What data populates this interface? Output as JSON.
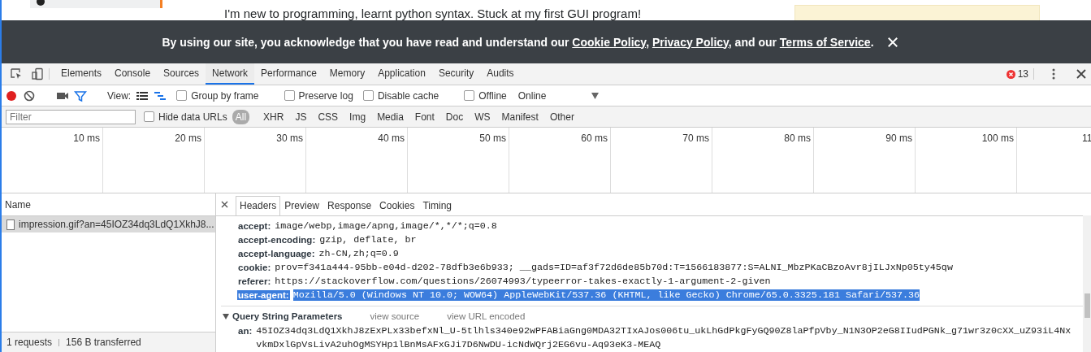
{
  "page": {
    "question": "I'm new to programming, learnt python syntax. Stuck at my first GUI program!"
  },
  "cookie_banner": {
    "segments": [
      {
        "kind": "text",
        "text": "By using our site, you acknowledge that you have read and understand our "
      },
      {
        "kind": "link",
        "text": "Cookie Policy"
      },
      {
        "kind": "text",
        "text": ", "
      },
      {
        "kind": "link",
        "text": "Privacy Policy"
      },
      {
        "kind": "text",
        "text": ", and our "
      },
      {
        "kind": "link",
        "text": "Terms of Service"
      },
      {
        "kind": "text",
        "text": "."
      }
    ]
  },
  "devtools": {
    "tabs": [
      {
        "label": "Elements",
        "selected": false
      },
      {
        "label": "Console",
        "selected": false
      },
      {
        "label": "Sources",
        "selected": false
      },
      {
        "label": "Network",
        "selected": true
      },
      {
        "label": "Performance",
        "selected": false
      },
      {
        "label": "Memory",
        "selected": false
      },
      {
        "label": "Application",
        "selected": false
      },
      {
        "label": "Security",
        "selected": false
      },
      {
        "label": "Audits",
        "selected": false
      }
    ],
    "error_count": "13",
    "toolbar": {
      "recording": true,
      "filter_on": true,
      "view_label": "View:",
      "view_modes": [
        {
          "kind": "list",
          "selected": false
        },
        {
          "kind": "waterfall",
          "selected": true
        }
      ],
      "checkboxes": [
        {
          "label": "Group by frame",
          "checked": false
        },
        {
          "label": "Preserve log",
          "checked": false
        },
        {
          "label": "Disable cache",
          "checked": false
        },
        {
          "label": "Offline",
          "checked": false
        }
      ],
      "throttling": "Online"
    },
    "filter_bar": {
      "placeholder": "Filter",
      "hide_data_urls": {
        "label": "Hide data URLs",
        "checked": false
      },
      "types": [
        {
          "label": "All",
          "selected": true
        },
        {
          "label": "XHR",
          "selected": false
        },
        {
          "label": "JS",
          "selected": false
        },
        {
          "label": "CSS",
          "selected": false
        },
        {
          "label": "Img",
          "selected": false
        },
        {
          "label": "Media",
          "selected": false
        },
        {
          "label": "Font",
          "selected": false
        },
        {
          "label": "Doc",
          "selected": false
        },
        {
          "label": "WS",
          "selected": false
        },
        {
          "label": "Manifest",
          "selected": false
        },
        {
          "label": "Other",
          "selected": false
        }
      ]
    },
    "timeline_ticks": [
      "10 ms",
      "20 ms",
      "30 ms",
      "40 ms",
      "50 ms",
      "60 ms",
      "70 ms",
      "80 ms",
      "90 ms",
      "100 ms",
      "11"
    ],
    "requests": {
      "column": "Name",
      "rows": [
        {
          "name": "impression.gif?an=45IOZ34dq3LdQ1XkhJ8...",
          "selected": true
        }
      ],
      "status": [
        "1 requests",
        "156 B transferred"
      ]
    },
    "details": {
      "tabs": [
        {
          "label": "Headers",
          "selected": true
        },
        {
          "label": "Preview",
          "selected": false
        },
        {
          "label": "Response",
          "selected": false
        },
        {
          "label": "Cookies",
          "selected": false
        },
        {
          "label": "Timing",
          "selected": false
        }
      ],
      "headers": [
        {
          "name": "accept:",
          "value": "image/webp,image/apng,image/*,*/*;q=0.8",
          "selected": false
        },
        {
          "name": "accept-encoding:",
          "value": "gzip, deflate, br",
          "selected": false
        },
        {
          "name": "accept-language:",
          "value": "zh-CN,zh;q=0.9",
          "selected": false
        },
        {
          "name": "cookie:",
          "value": "prov=f341a444-95bb-e04d-d202-78dfb3e6b933; __gads=ID=af3f72d6de85b70d:T=1566183877:S=ALNI_MbzPKaCBzoAvr8jILJxNp05ty45qw",
          "selected": false
        },
        {
          "name": "referer:",
          "value": "https://stackoverflow.com/questions/26074993/typeerror-takes-exactly-1-argument-2-given",
          "selected": false
        },
        {
          "name": "user-agent:",
          "value": "Mozilla/5.0 (Windows NT 10.0; WOW64) AppleWebKit/537.36 (KHTML, like Gecko) Chrome/65.0.3325.181 Safari/537.36",
          "selected": true
        }
      ],
      "query": {
        "title": "Query String Parameters",
        "expanded": true,
        "links": [
          "view source",
          "view URL encoded"
        ],
        "params": [
          {
            "name": "an:",
            "value": "45IOZ34dq3LdQ1XkhJ8zExPLx33befxNl_U-5tlhls340e92wPFABiaGng0MDA32TIxAJos006tu_ukLhGdPkgFyGQ90Z8laPfpVby_N1N3OP2eG8IIudPGNk_g71wr3z0cXX_uZ93iL4NxvkmDxlGpVsLivA2uhOgMSYHp1lBnMsAFxGJi7D6NwDU-icNdWQrj2EG6vu-Aq93eK3-MEAQ"
          }
        ]
      }
    }
  }
}
